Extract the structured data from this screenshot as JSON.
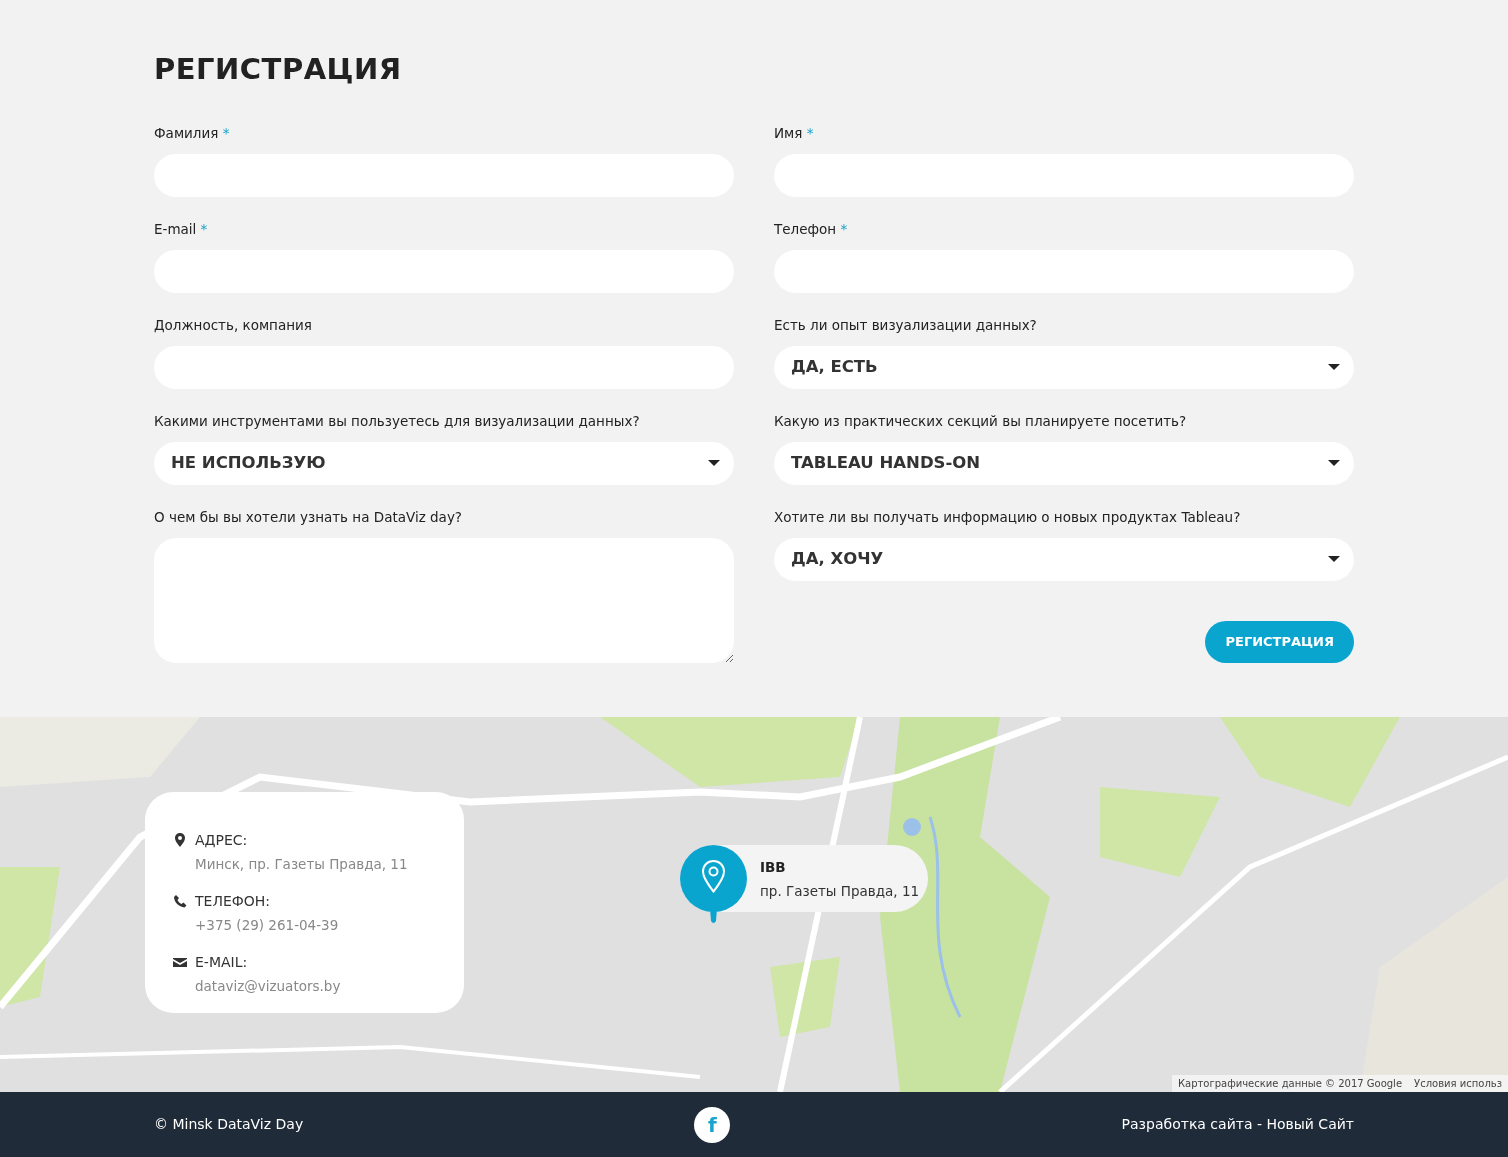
{
  "title": "РЕГИСТРАЦИЯ",
  "rows": [
    {
      "fields": [
        {
          "kind": "text",
          "label": "Фамилия",
          "required_mark": "*"
        },
        {
          "kind": "text",
          "label": "Имя",
          "required_mark": "*"
        }
      ]
    },
    {
      "fields": [
        {
          "kind": "text",
          "label": "E-mail",
          "required_mark": "*"
        },
        {
          "kind": "text",
          "label": "Телефон",
          "required_mark": "*"
        }
      ]
    },
    {
      "fields": [
        {
          "kind": "text",
          "label": "Должность, компания"
        },
        {
          "kind": "select",
          "label": "Есть ли опыт визуализации данных?",
          "value": "ДА, ЕСТЬ"
        }
      ]
    },
    {
      "fields": [
        {
          "kind": "select",
          "label": "Какими инструментами вы пользуетесь для визуализации данных?",
          "value": "НЕ ИСПОЛЬЗУЮ"
        },
        {
          "kind": "select",
          "label": "Какую из практических секций вы планируете посетить?",
          "value": "TABLEAU HANDS-ON"
        }
      ]
    },
    {
      "fields": [
        {
          "kind": "textarea",
          "label": "О чем бы вы хотели узнать на DataViz day?"
        },
        {
          "kind": "select",
          "label": "Хотите ли вы получать информацию о новых продуктах Tableau?",
          "value": "ДА, ХОЧУ"
        }
      ]
    }
  ],
  "submit_button": {
    "label": "РЕГИСТРАЦИЯ"
  },
  "map": {
    "kind": "picture",
    "contact_card": [
      {
        "kind": "address",
        "heading": "АДРЕС:",
        "text": "Минск, пр. Газеты Правда, 11"
      },
      {
        "kind": "phone",
        "heading": "ТЕЛЕФОН:",
        "text": "+375 (29) 261-04-39"
      },
      {
        "kind": "email",
        "heading": "E-MAIL:",
        "text": "dataviz@vizuators.by"
      }
    ],
    "marker": {
      "name": "IBB",
      "address": "пр. Газеты Правда, 11"
    },
    "attribution": [
      "Картографические данные © 2017 Google",
      "Условия использ"
    ]
  },
  "footer": {
    "copyright": "© Minsk DataViz Day",
    "social": [
      {
        "kind": "facebook",
        "glyph": "f"
      }
    ],
    "credit": "Разработка сайта - Новый Сайт"
  }
}
